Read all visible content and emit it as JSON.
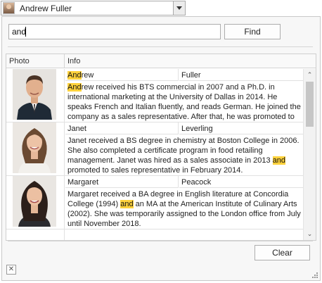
{
  "combo": {
    "value": "Andrew Fuller",
    "avatar_icon": "person-photo-icon",
    "dropdown_icon": "chevron-down-icon"
  },
  "search": {
    "value": "and",
    "button_label": "Find"
  },
  "grid": {
    "columns": [
      "Photo",
      "Info"
    ],
    "rows": [
      {
        "first_name": {
          "pre": "",
          "hl": "And",
          "post": "rew"
        },
        "last_name": "Fuller",
        "notes": {
          "a": "",
          "hl": "And",
          "b": "rew received his BTS commercial in 2007 and a Ph.D. in international marketing at the University of Dallas in 2014. He speaks French and Italian fluently, and reads German. He joined the company as a sales representative. After that, he was promoted to"
        }
      },
      {
        "first_name": {
          "pre": "Janet",
          "hl": "",
          "post": ""
        },
        "last_name": "Leverling",
        "notes": {
          "a": "Janet received a BS degree in chemistry at Boston College in 2006. She also completed a certificate program in food retailing management. Janet was hired as a sales associate in 2013 ",
          "hl": "and",
          "b": " promoted to sales representative in February 2014."
        }
      },
      {
        "first_name": {
          "pre": "Margaret",
          "hl": "",
          "post": ""
        },
        "last_name": "Peacock",
        "notes": {
          "a": "Margaret received a BA degree in English literature at Concordia College (1994) ",
          "hl": "and",
          "b": " an MA at the American Institute of Culinary Arts (2002). She was temporarily assigned to the London office from July until  November 2018."
        }
      }
    ]
  },
  "clear_label": "Clear",
  "close_icon": "close-icon",
  "colors": {
    "highlight": "#ffd23c",
    "border": "#adadad"
  }
}
